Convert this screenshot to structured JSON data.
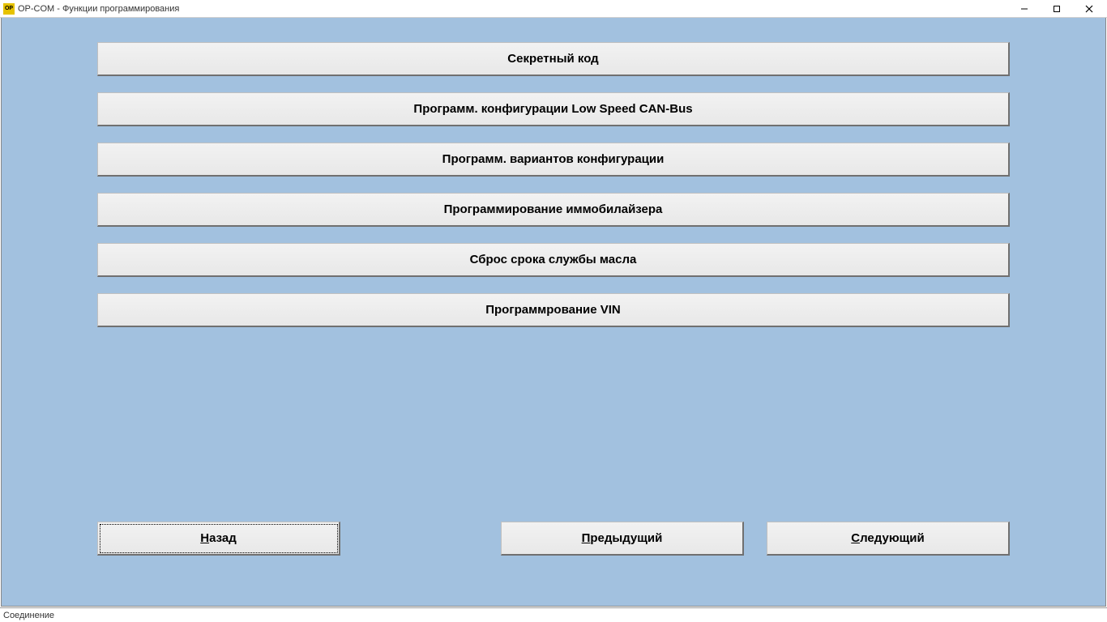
{
  "window": {
    "title": "OP-COM - Функции программирования"
  },
  "options": [
    {
      "label": "Секретный код",
      "name": "secret-code-button"
    },
    {
      "label": "Программ. конфигурации Low Speed CAN-Bus",
      "name": "low-speed-canbus-config-button"
    },
    {
      "label": "Программ. вариантов конфигурации",
      "name": "variant-config-button"
    },
    {
      "label": "Программирование иммобилайзера",
      "name": "immobilizer-programming-button"
    },
    {
      "label": "Сброс срока службы масла",
      "name": "oil-life-reset-button"
    },
    {
      "label": "Программрование VIN",
      "name": "vin-programming-button"
    }
  ],
  "nav": {
    "back": "Назад",
    "prev": "Предыдущий",
    "next": "Следующий"
  },
  "status": {
    "text": "Соединение"
  }
}
